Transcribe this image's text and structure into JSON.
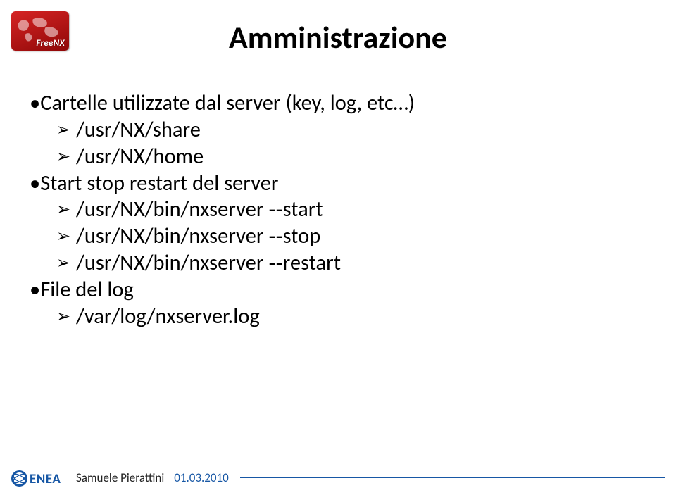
{
  "logo": {
    "label": "FreeNX"
  },
  "title": "Amministrazione",
  "items": [
    {
      "kind": "l0",
      "text": "•Cartelle utilizzate dal server (key, log, etc…)"
    },
    {
      "kind": "l1",
      "text": "/usr/NX/share"
    },
    {
      "kind": "l1",
      "text": "/usr/NX/home"
    },
    {
      "kind": "l0",
      "text": "•Start stop restart del server"
    },
    {
      "kind": "l1",
      "text": "/usr/NX/bin/nxserver ‐‐start"
    },
    {
      "kind": "l1",
      "text": "/usr/NX/bin/nxserver ‐‐stop"
    },
    {
      "kind": "l1",
      "text": "/usr/NX/bin/nxserver ‐‐restart"
    },
    {
      "kind": "l0",
      "text": "•File del log"
    },
    {
      "kind": "l1",
      "text": "/var/log/nxserver.log"
    }
  ],
  "footer": {
    "brand": "ENEA",
    "author": "Samuele Pierattini",
    "date": "01.03.2010"
  }
}
